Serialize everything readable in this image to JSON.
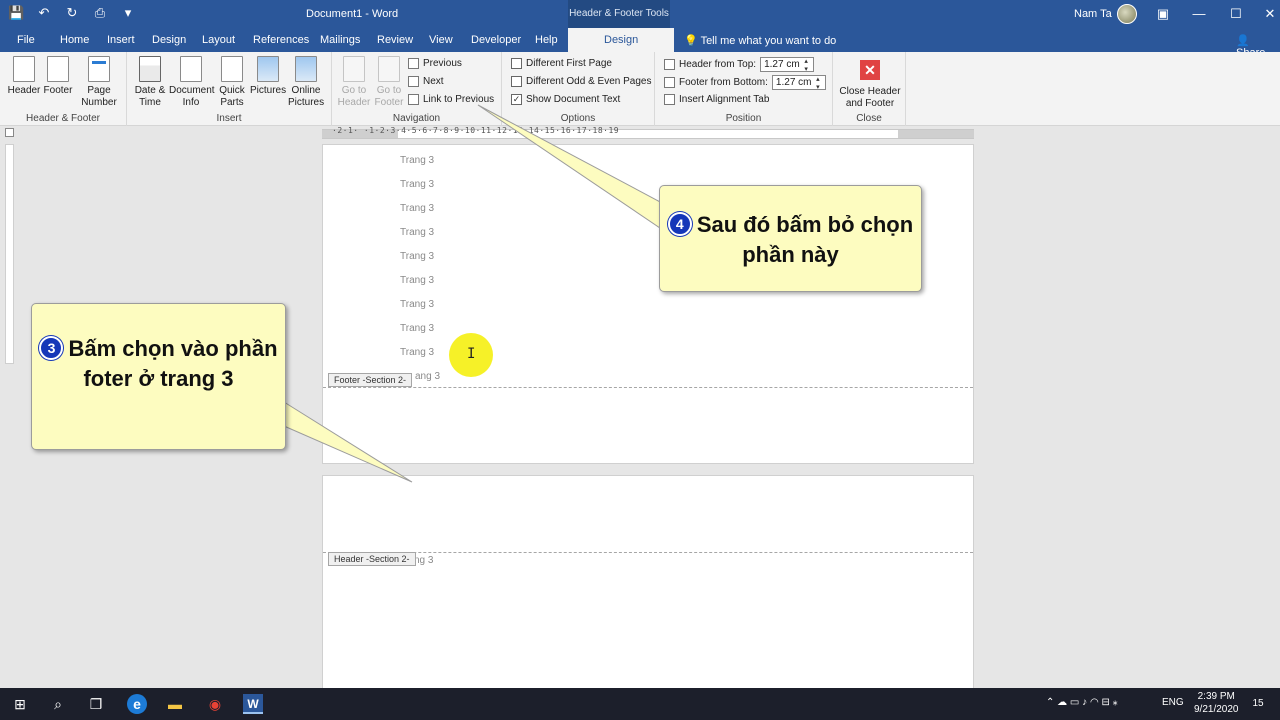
{
  "titlebar": {
    "doc_title": "Document1  -  Word",
    "context_title": "Header & Footer Tools",
    "user_name": "Nam Ta",
    "save_glyph": "💾",
    "undo_glyph": "↶",
    "redo_glyph": "↻",
    "preview_glyph": "⎙",
    "qat_more_glyph": "▾",
    "ribbon_display_glyph": "▣",
    "minimize_glyph": "—",
    "maximize_glyph": "☐",
    "close_glyph": "✕"
  },
  "tabs": {
    "file": "File",
    "home": "Home",
    "insert": "Insert",
    "design": "Design",
    "layout": "Layout",
    "references": "References",
    "mailings": "Mailings",
    "review": "Review",
    "view": "View",
    "developer": "Developer",
    "help": "Help",
    "hf_design": "Design",
    "tell_me": "Tell me what you want to do",
    "share": "Share",
    "tell_me_icon": "💡",
    "share_icon": "👤"
  },
  "ribbon": {
    "hf_group": {
      "label": "Header & Footer",
      "header": "Header",
      "footer": "Footer",
      "page_number": "Page Number"
    },
    "insert_group": {
      "label": "Insert",
      "date_time": "Date & Time",
      "document_info": "Document Info",
      "quick_parts": "Quick Parts",
      "pictures": "Pictures",
      "online_pictures": "Online Pictures"
    },
    "nav_group": {
      "label": "Navigation",
      "go_to_header": "Go to Header",
      "go_to_footer": "Go to Footer",
      "previous": "Previous",
      "next": "Next",
      "link_to_previous": "Link to Previous"
    },
    "options_group": {
      "label": "Options",
      "different_first_page": "Different First Page",
      "different_odd_even": "Different Odd & Even Pages",
      "show_document_text": "Show Document Text",
      "show_document_text_checked": true
    },
    "position_group": {
      "label": "Position",
      "header_from_top": "Header from Top:",
      "header_from_top_value": "1.27 cm",
      "footer_from_bottom": "Footer from Bottom:",
      "footer_from_bottom_value": "1.27 cm",
      "insert_alignment_tab": "Insert Alignment Tab"
    },
    "close_group": {
      "label": "Close",
      "close_button": "Close Header and Footer"
    }
  },
  "ruler": {
    "numbers": "·2·1·  ·1·2·3·4·5·6·7·8·9·10·11·12·13·14·15·16·17·18·19"
  },
  "document": {
    "page1_lines": [
      "Trang 3",
      "Trang 3",
      "Trang 3",
      "Trang 3",
      "Trang 3",
      "Trang 3",
      "Trang 3",
      "Trang 3",
      "Trang 3",
      "ang 3"
    ],
    "footer_tag": "Footer -Section 2-",
    "header_tag": "Header -Section 2-",
    "page2_line": "ng 3"
  },
  "callouts": {
    "step4_num": "4",
    "step4_text": "Sau đó bấm bỏ chọn phần này",
    "step3_num": "3",
    "step3_text": "Bấm chọn vào phần foter ở trang 3"
  },
  "taskbar": {
    "start_glyph": "⊞",
    "search_glyph": "⌕",
    "taskview_glyph": "❐",
    "edge_glyph": "e",
    "explorer_glyph": "▬",
    "chrome_glyph": "◉",
    "word_glyph": "W",
    "tray_icons": "⌃  ☁  ▭  ♪  ◠  ⊟  ⁎",
    "language": "ENG",
    "time": "2:39 PM",
    "date": "9/21/2020",
    "notification_count": "15"
  }
}
